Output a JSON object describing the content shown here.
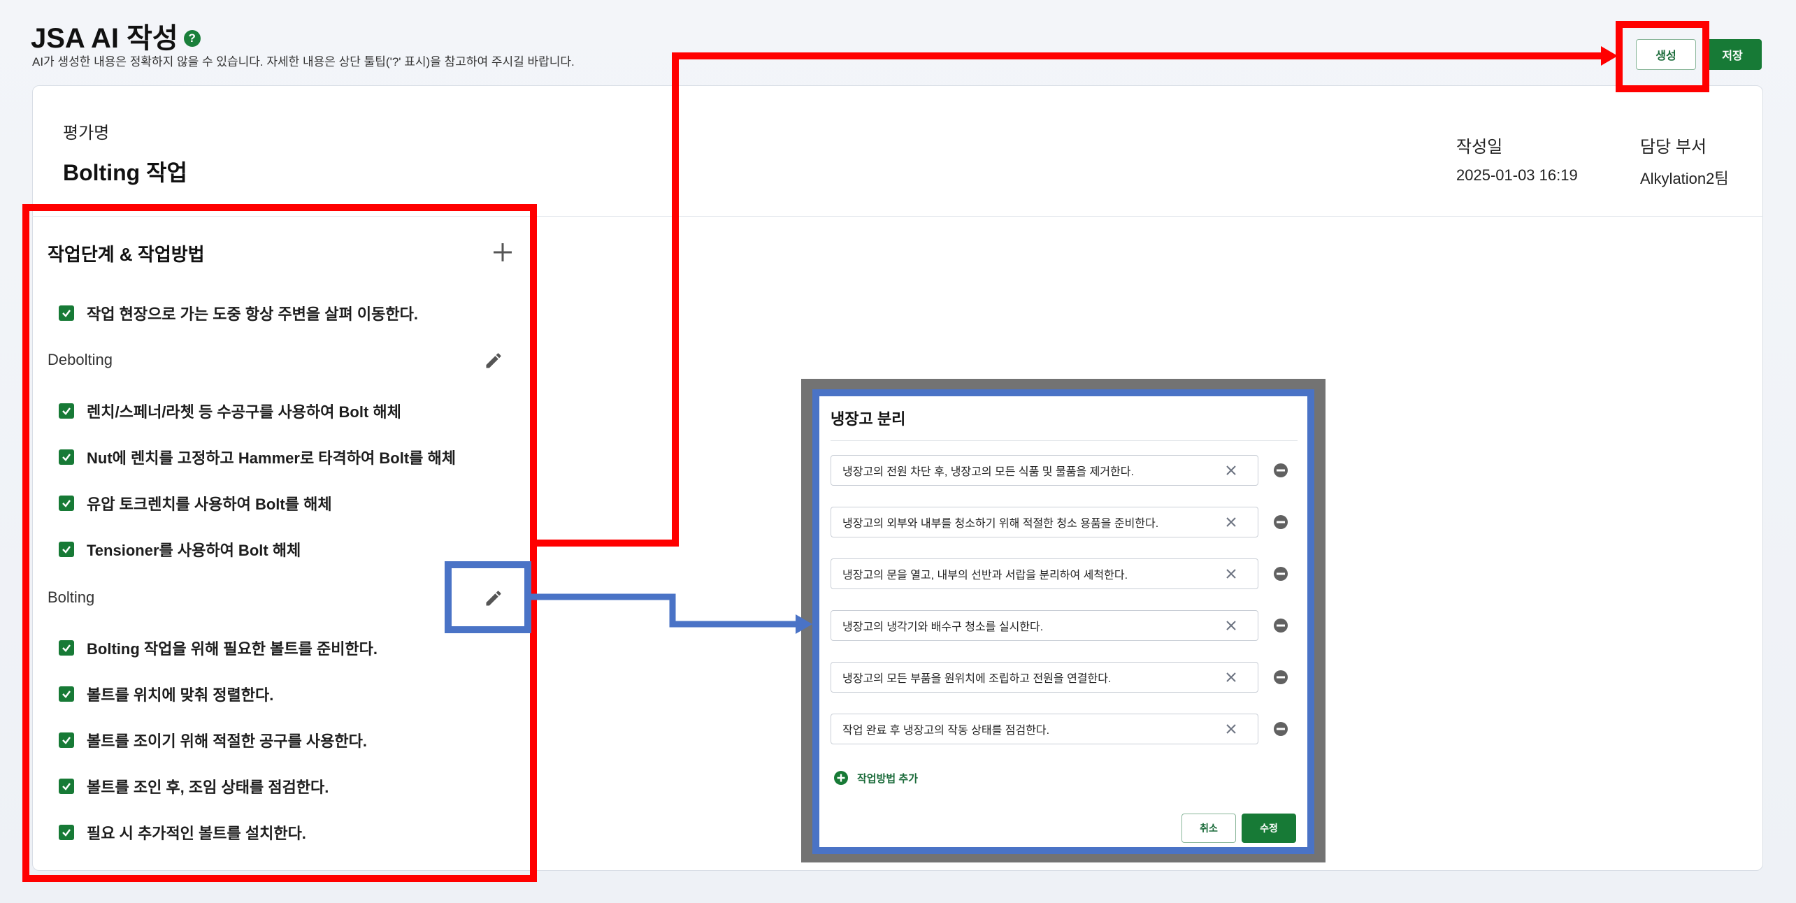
{
  "header": {
    "title": "JSA AI 작성",
    "help_icon": "?",
    "subtitle": "AI가 생성한 내용은 정확하지 않을 수 있습니다. 자세한 내용은 상단 툴팁('?' 표시)을 참고하여 주시길 바랍니다.",
    "generate_label": "생성",
    "save_label": "저장"
  },
  "info": {
    "eval_name_label": "평가명",
    "eval_name": "Bolting 작업",
    "date_label": "작성일",
    "date_value": "2025-01-03 16:19",
    "dept_label": "담당 부서",
    "dept_value": "Alkylation2팀"
  },
  "steps_panel": {
    "title": "작업단계 & 작업방법",
    "intro_item": "작업 현장으로 가는 도중 항상 주변을 살펴 이동한다.",
    "groups": [
      {
        "name": "Debolting",
        "items": [
          "렌치/스페너/라쳇 등 수공구를 사용하여 Bolt 해체",
          "Nut에 렌치를 고정하고 Hammer로 타격하여 Bolt를 해체",
          "유압 토크렌치를 사용하여 Bolt를 해체",
          "Tensioner를 사용하여 Bolt 해체"
        ]
      },
      {
        "name": "Bolting",
        "items": [
          "Bolting 작업을 위해 필요한 볼트를 준비한다.",
          "볼트를 위치에 맞춰 정렬한다.",
          "볼트를 조이기 위해 적절한 공구를 사용한다.",
          "볼트를 조인 후, 조임 상태를 점검한다.",
          "필요 시 추가적인 볼트를 설치한다."
        ]
      }
    ]
  },
  "modal": {
    "title": "냉장고 분리",
    "fields": [
      "냉장고의 전원 차단 후, 냉장고의 모든 식품 및 물품을 제거한다.",
      "냉장고의 외부와 내부를 청소하기 위해 적절한 청소 용품을 준비한다.",
      "냉장고의 문을 열고, 내부의 선반과 서랍을 분리하여 세척한다.",
      "냉장고의 냉각기와 배수구 청소를 실시한다.",
      "냉장고의 모든 부품을 원위치에 조립하고 전원을 연결한다.",
      "작업 완료 후 냉장고의 작동 상태를 점검한다."
    ],
    "add_label": "작업방법 추가",
    "cancel_label": "취소",
    "confirm_label": "수정"
  },
  "colors": {
    "brand_green": "#177a36",
    "annotation_red": "#ff0000",
    "annotation_blue": "#4a73c6"
  }
}
